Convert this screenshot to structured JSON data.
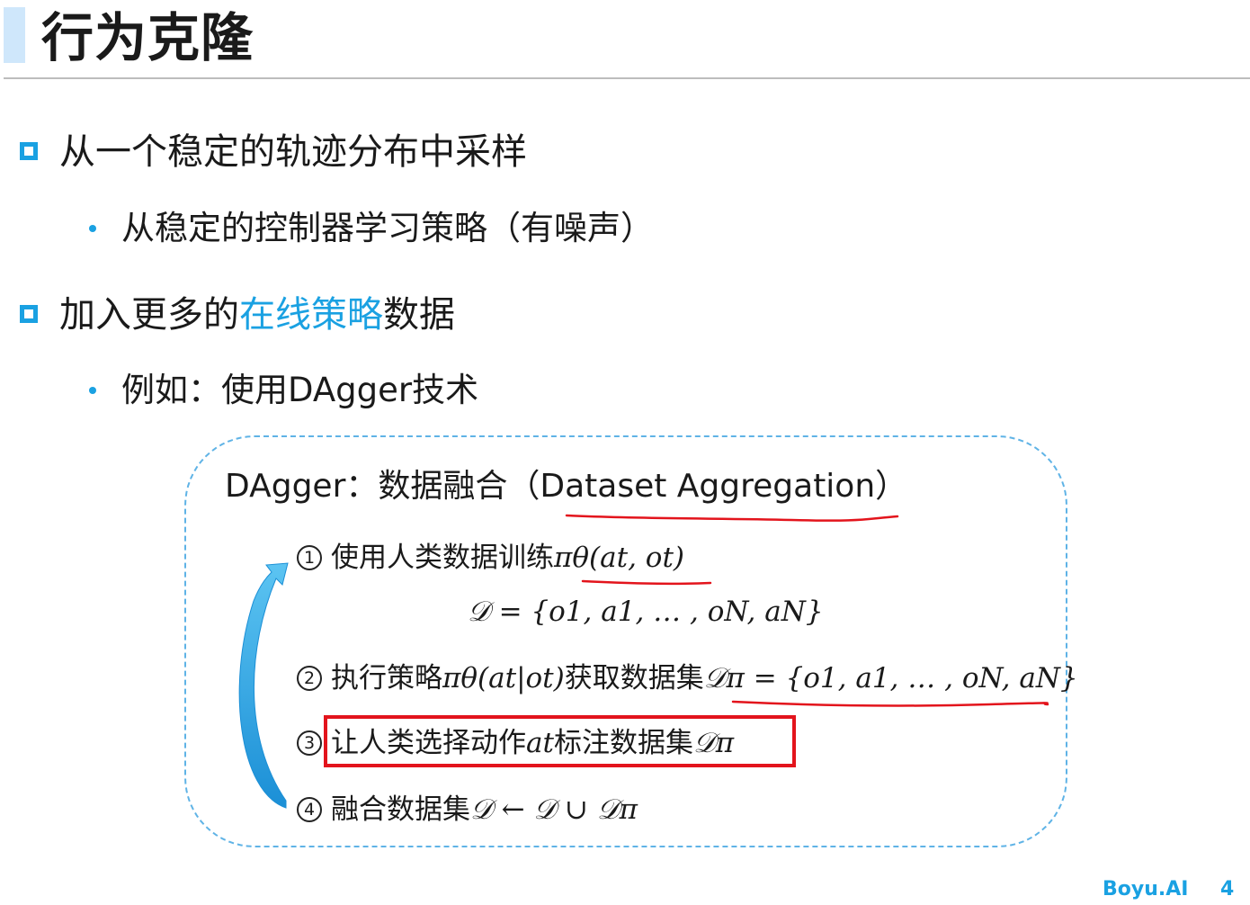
{
  "slide": {
    "title": "行为克隆",
    "page_number": "4",
    "brand": "Boyu.AI"
  },
  "bullets": [
    {
      "text": "从一个稳定的轨迹分布中采样",
      "sub": [
        "从稳定的控制器学习策略（有噪声）"
      ]
    },
    {
      "text_before": "加入更多的",
      "text_highlight": "在线策略",
      "text_after": "数据",
      "sub": [
        "例如：使用DAgger技术"
      ]
    }
  ],
  "dagger": {
    "title": "DAgger：数据融合（Dataset Aggregation）",
    "steps": [
      {
        "num": "1",
        "text": "使用人类数据训练",
        "math": "πθ(at, ot)"
      },
      {
        "num": "2",
        "text_before": "执行策略",
        "math1": "πθ(at|ot)",
        "text_mid": "获取数据集",
        "math2": "𝒟π = {o1, a1, … , oN, aN}"
      },
      {
        "num": "3",
        "text_before": "让人类选择动作",
        "math1": "at",
        "text_mid": "标注数据集",
        "math2": "𝒟π"
      },
      {
        "num": "4",
        "text_before": "融合数据集",
        "math": "𝒟 ← 𝒟 ∪ 𝒟π"
      }
    ],
    "formula": "𝒟 = {o1, a1, … , oN, aN}"
  },
  "colors": {
    "accent": "#1aa1e2",
    "annotation_red": "#e3141c",
    "title_bar": "#cfe7fb",
    "dashed_border": "#5fb3e6"
  }
}
